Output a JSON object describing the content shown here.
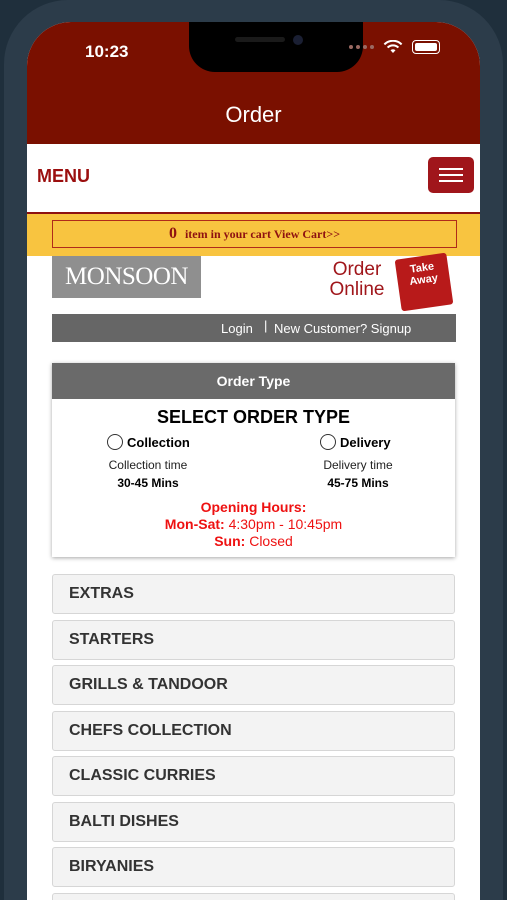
{
  "status": {
    "time": "10:23"
  },
  "appbar": {
    "title": "Order"
  },
  "menu": {
    "label": "MENU"
  },
  "cart": {
    "count": "0",
    "text": "item in your cart View Cart>>"
  },
  "brand": {
    "logo_text": "MONSOON",
    "order_online": "Order Online",
    "badge": "Take Away"
  },
  "account": {
    "login": "Login",
    "separator": "|",
    "signup": "New Customer? Signup"
  },
  "order_type": {
    "header": "Order Type",
    "title": "SELECT ORDER TYPE",
    "collection_label": "Collection",
    "collection_time_label": "Collection time",
    "collection_mins": "30-45 Mins",
    "delivery_label": "Delivery",
    "delivery_time_label": "Delivery time",
    "delivery_mins": "45-75 Mins",
    "hours_title": "Opening Hours:",
    "mon_sat_label": "Mon-Sat:",
    "mon_sat_hours": "4:30pm - 10:45pm",
    "sun_label": "Sun:",
    "sun_hours": "Closed"
  },
  "categories": [
    "EXTRAS",
    "STARTERS",
    "GRILLS & TANDOOR",
    "CHEFS COLLECTION",
    "CLASSIC CURRIES",
    "BALTI DISHES",
    "BIRYANIES"
  ],
  "colors": {
    "appbar": "#7a1000",
    "accent": "#a0161b",
    "cart_band": "#f8c440",
    "hours": "#e11111"
  }
}
